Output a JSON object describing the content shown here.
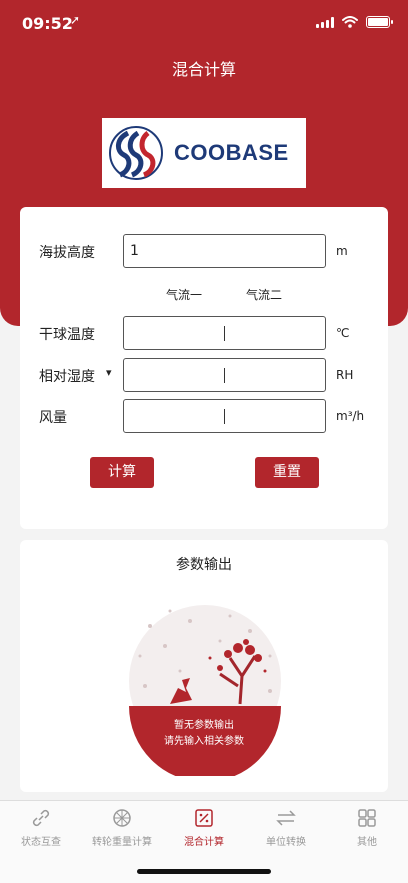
{
  "status_bar": {
    "time": "09:52",
    "location_glyph": "➚"
  },
  "nav": {
    "title": "混合计算"
  },
  "logo": {
    "brand": "COOBASE"
  },
  "form": {
    "altitude": {
      "label": "海拔高度",
      "value": "1",
      "unit": "m"
    },
    "stream_headers": {
      "stream1": "气流一",
      "stream2": "气流二"
    },
    "dry_bulb": {
      "label": "干球温度",
      "unit": "℃",
      "stream1_value": "",
      "stream2_value": ""
    },
    "humidity": {
      "label": "相对湿度",
      "dropdown_glyph": "▾",
      "unit": "RH",
      "stream1_value": "",
      "stream2_value": ""
    },
    "airflow": {
      "label": "风量",
      "unit": "m³/h",
      "stream1_value": "",
      "stream2_value": ""
    },
    "calc_button": "计算",
    "reset_button": "重置"
  },
  "output": {
    "title": "参数输出",
    "empty_line1": "暂无参数输出",
    "empty_line2": "请先输入相关参数"
  },
  "tabs": [
    {
      "label": "状态互查",
      "icon": "link-icon",
      "active": false
    },
    {
      "label": "转轮重量计算",
      "icon": "wheel-icon",
      "active": false
    },
    {
      "label": "混合计算",
      "icon": "percent-icon",
      "active": true
    },
    {
      "label": "单位转换",
      "icon": "swap-icon",
      "active": false
    },
    {
      "label": "其他",
      "icon": "grid-icon",
      "active": false
    }
  ],
  "colors": {
    "accent": "#b2262c",
    "brand_blue": "#1e3a78",
    "inactive": "#999999"
  }
}
